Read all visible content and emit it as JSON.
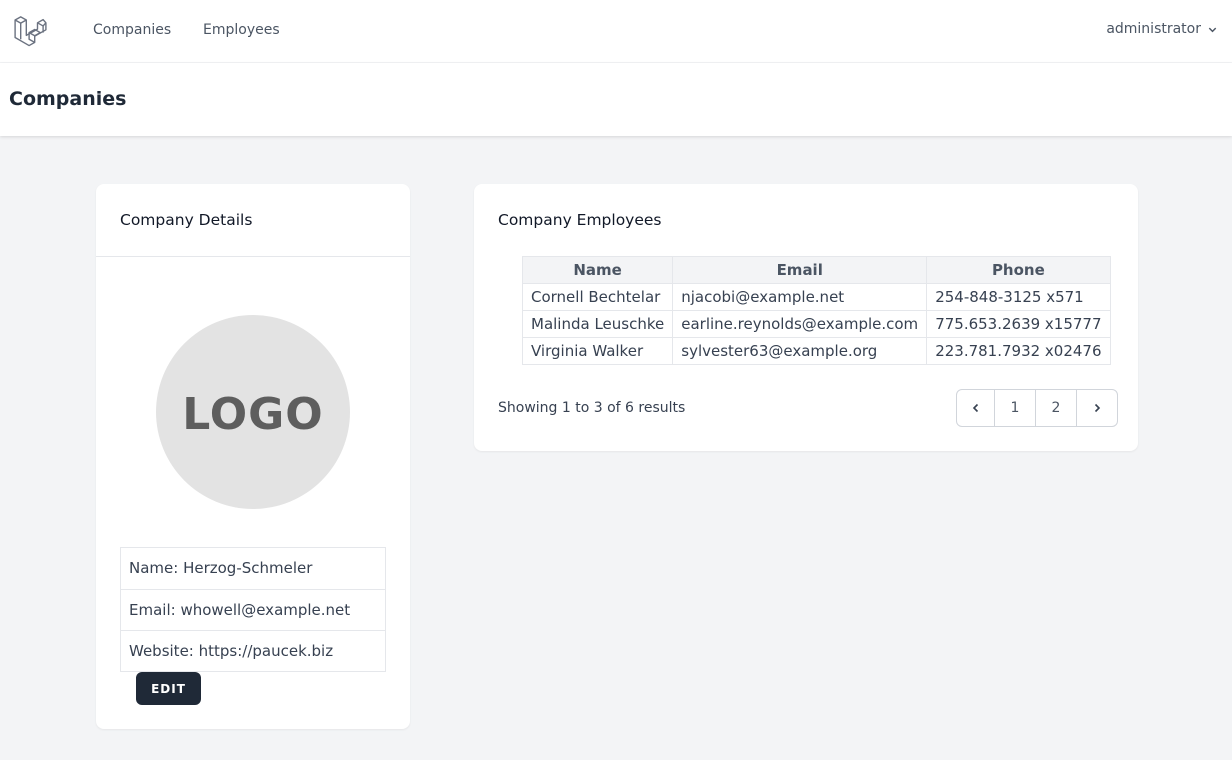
{
  "nav": {
    "items": [
      {
        "label": "Companies"
      },
      {
        "label": "Employees"
      }
    ],
    "user": "administrator"
  },
  "page": {
    "title": "Companies"
  },
  "company_card": {
    "title": "Company Details",
    "logo_text": "LOGO",
    "details": [
      "Name: Herzog-Schmeler",
      "Email: whowell@example.net",
      "Website: https://paucek.biz"
    ],
    "edit_label": "EDIT"
  },
  "employees_card": {
    "title": "Company Employees",
    "columns": [
      "Name",
      "Email",
      "Phone"
    ],
    "rows": [
      [
        "Cornell Bechtelar",
        "njacobi@example.net",
        "254-848-3125 x571"
      ],
      [
        "Malinda Leuschke",
        "earline.reynolds@example.com",
        "775.653.2639 x15777"
      ],
      [
        "Virginia Walker",
        "sylvester63@example.org",
        "223.781.7932 x02476"
      ]
    ],
    "showing": "Showing 1 to 3 of 6 results",
    "pages": [
      "1",
      "2"
    ]
  },
  "colors": {
    "button": "#1f2937",
    "background": "#f3f4f6",
    "logo_circle": "#e3e3e3"
  }
}
